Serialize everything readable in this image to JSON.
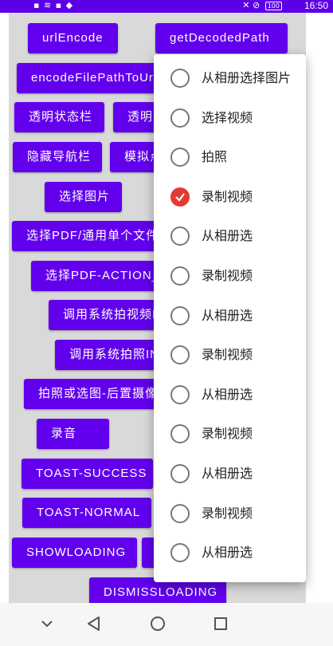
{
  "status_bar": {
    "left_icons": "▪ ≋ ▪ ◆",
    "right_icons": "✕ ⊘",
    "battery": "100",
    "time": "16:50"
  },
  "buttons": [
    "urlEncode",
    "getDecodedPath",
    "encodeFilePathToUri",
    "透明状态栏",
    "透明",
    "隐藏导航栏",
    "模拟点",
    "选择图片",
    "选择PDF/通用单个文件",
    "选择PDF-ACTION_",
    "调用系统拍视频I",
    "调用系统拍照IN",
    "拍照或选图-后置摄像",
    "录音",
    "TOAST-SUCCESS",
    "TOAST-NORMAL",
    "SHOWLOADING",
    "DISMISSLOADING"
  ],
  "menu": {
    "items": [
      {
        "label": "从相册选择图片",
        "checked": false
      },
      {
        "label": "选择视频",
        "checked": false
      },
      {
        "label": "拍照",
        "checked": false
      },
      {
        "label": "录制视频",
        "checked": true
      },
      {
        "label": "从相册选",
        "checked": false
      },
      {
        "label": "录制视频",
        "checked": false
      },
      {
        "label": "从相册选",
        "checked": false
      },
      {
        "label": "录制视频",
        "checked": false
      },
      {
        "label": "从相册选",
        "checked": false
      },
      {
        "label": "录制视频",
        "checked": false
      },
      {
        "label": "从相册选",
        "checked": false
      },
      {
        "label": "录制视频",
        "checked": false
      },
      {
        "label": "从相册选",
        "checked": false
      }
    ]
  },
  "colors": {
    "primary": "#6200ee",
    "accent": "#e53935",
    "status_bar": "#5b00e6",
    "background": "#d9d9d9"
  },
  "icons": {
    "nav_back": "triangle-back-icon",
    "nav_home": "circle-home-icon",
    "nav_recent": "square-recent-icon",
    "nav_down": "chevron-down-icon"
  }
}
